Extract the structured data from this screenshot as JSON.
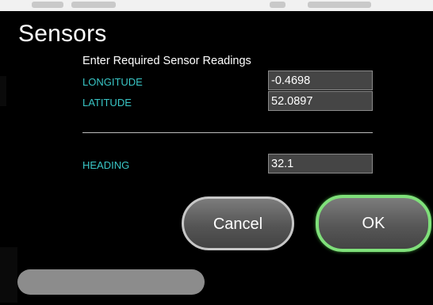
{
  "dialog": {
    "title": "Sensors",
    "prompt": "Enter Required Sensor Readings"
  },
  "fields": {
    "longitude": {
      "label": "LONGITUDE",
      "value": "-0.4698"
    },
    "latitude": {
      "label": "LATITUDE",
      "value": "52.0897"
    },
    "heading": {
      "label": "HEADING",
      "value": "32.1"
    }
  },
  "buttons": {
    "cancel_label": "Cancel",
    "ok_label": "OK"
  },
  "colors": {
    "label_cyan": "#39c6c6",
    "ok_border_green": "#7fe07a",
    "input_background": "#454545"
  }
}
